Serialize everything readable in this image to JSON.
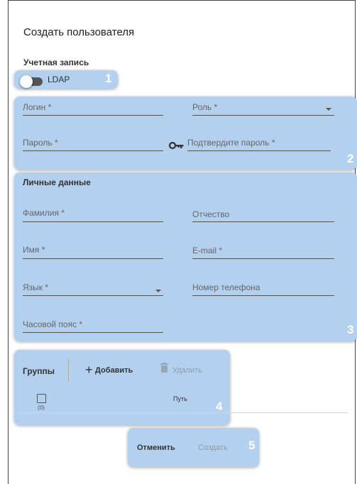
{
  "dialog": {
    "title": "Создать пользователя",
    "account_section": "Учетная запись"
  },
  "ldap": {
    "label": "LDAP",
    "enabled": false
  },
  "account": {
    "login": "Логин *",
    "role": "Роль *",
    "password": "Пароль *",
    "confirm_password": "Подтвердите пароль *"
  },
  "personal": {
    "section": "Личные данные",
    "last_name": "Фамилия *",
    "middle_name": "Отчество",
    "first_name": "Имя *",
    "email": "E-mail *",
    "language": "Язык *",
    "phone": "Номер телефона",
    "timezone": "Часовой пояс *"
  },
  "groups": {
    "label": "Группы",
    "add": "Добавить",
    "delete": "Удалить",
    "count": "(0)",
    "path_column": "Путь"
  },
  "actions": {
    "cancel": "Отменить",
    "create": "Создать"
  },
  "callouts": [
    "1",
    "2",
    "3",
    "4",
    "5"
  ],
  "colors": {
    "highlight": "#b3d0ef",
    "callout_text": "#ffffff"
  },
  "icons": [
    "toggle-icon",
    "key-icon",
    "plus-icon",
    "trash-icon",
    "checkbox-icon",
    "dropdown-caret-icon"
  ]
}
